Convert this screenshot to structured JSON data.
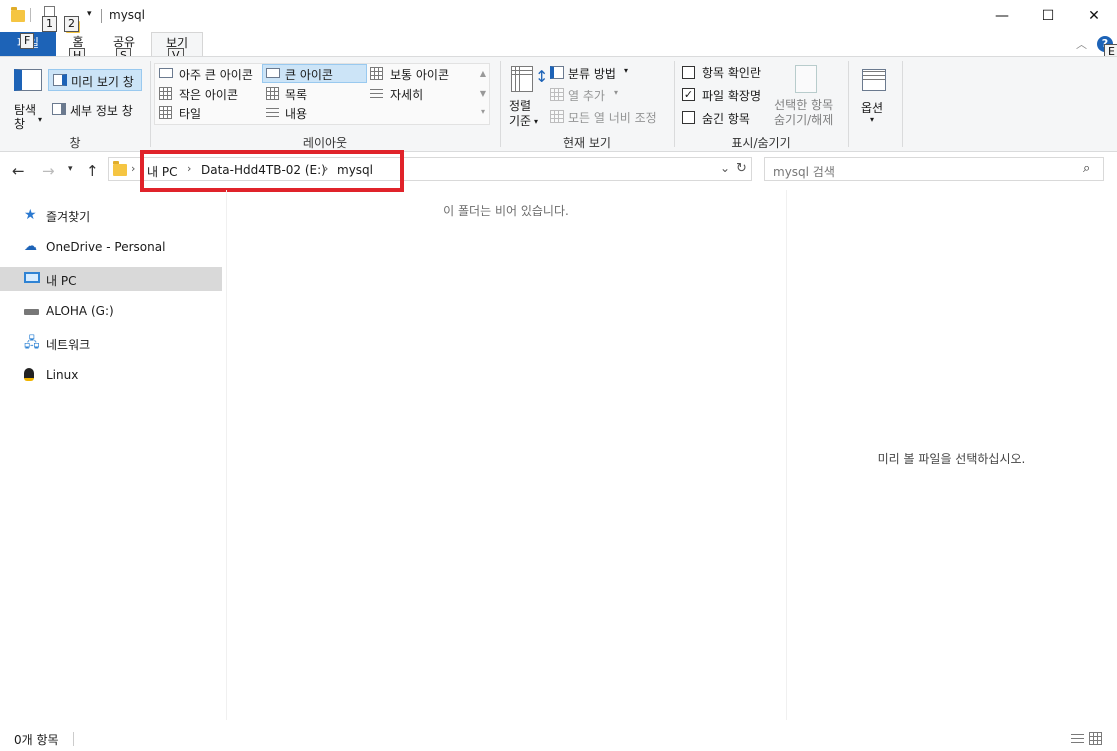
{
  "window": {
    "title": "mysql",
    "qat_keytips": [
      "1",
      "2"
    ],
    "controls": {
      "minimize": "—",
      "maximize": "☐",
      "close": "✕"
    }
  },
  "ribbon": {
    "tabs": [
      {
        "label": "파일",
        "keytip": "F"
      },
      {
        "label": "홈",
        "keytip": "H"
      },
      {
        "label": "공유",
        "keytip": "S"
      },
      {
        "label": "보기",
        "keytip": "V",
        "active": true
      }
    ],
    "help_keytip": "E",
    "panes_group": {
      "label": "창",
      "nav_pane": "탐색\n창",
      "preview_pane": "미리 보기 창",
      "details_pane": "세부 정보 창"
    },
    "layout_group": {
      "label": "레이아웃",
      "options": [
        [
          "아주 큰 아이콘",
          "큰 아이콘",
          "보통 아이콘"
        ],
        [
          "작은 아이콘",
          "목록",
          "자세히"
        ],
        [
          "타일",
          "내용"
        ]
      ],
      "selected": "큰 아이콘"
    },
    "current_view_group": {
      "label": "현재 보기",
      "sort_by": "정렬\n기준",
      "group_by": "분류 방법",
      "add_columns": "열 추가",
      "size_all_columns": "모든 열 너비 조정"
    },
    "show_hide_group": {
      "label": "표시/숨기기",
      "item_checkboxes": {
        "label": "항목 확인란",
        "checked": false
      },
      "file_extensions": {
        "label": "파일 확장명",
        "checked": true
      },
      "hidden_items": {
        "label": "숨긴 항목",
        "checked": false
      },
      "hide_selected": "선택한 항목\n숨기기/해제"
    },
    "options": "옵션"
  },
  "address_bar": {
    "breadcrumbs": [
      "내 PC",
      "Data-Hdd4TB-02 (E:)",
      "mysql"
    ],
    "search_placeholder": "mysql 검색"
  },
  "nav_pane": {
    "items": [
      {
        "label": "즐겨찾기",
        "icon": "star-icon"
      },
      {
        "label": "OneDrive - Personal",
        "icon": "cloud-icon"
      },
      {
        "label": "내 PC",
        "icon": "pc-icon",
        "selected": true
      },
      {
        "label": "ALOHA (G:)",
        "icon": "drive-icon"
      },
      {
        "label": "네트워크",
        "icon": "network-icon"
      },
      {
        "label": "Linux",
        "icon": "linux-icon"
      }
    ]
  },
  "content": {
    "empty_message": "이 폴더는 비어 있습니다.",
    "preview_message": "미리 볼 파일을 선택하십시오."
  },
  "status_bar": {
    "item_count": "0개 항목"
  },
  "colors": {
    "accent": "#1d63b7",
    "highlight_box": "#e0232a",
    "selected_nav": "#d9d9d9"
  }
}
